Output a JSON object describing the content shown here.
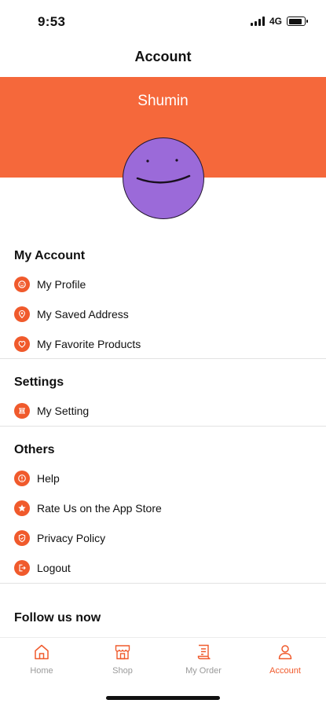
{
  "status": {
    "time": "9:53",
    "network": "4G",
    "battery_level": 0.85,
    "signal_icon": "signal-icon",
    "battery_icon": "battery-icon"
  },
  "header": {
    "title": "Account"
  },
  "profile": {
    "name": "Shumin",
    "banner_color": "#f5683b",
    "avatar_color": "#9b6ad9"
  },
  "accent_color": "#f05a2c",
  "sections": {
    "my_account": {
      "title": "My Account",
      "items": [
        {
          "label": "My Profile",
          "icon": "profile-icon"
        },
        {
          "label": "My Saved Address",
          "icon": "location-pin-icon"
        },
        {
          "label": "My Favorite Products",
          "icon": "heart-icon"
        }
      ]
    },
    "settings": {
      "title": "Settings",
      "items": [
        {
          "label": "My Setting",
          "icon": "settings-icon"
        }
      ]
    },
    "others": {
      "title": "Others",
      "items": [
        {
          "label": "Help",
          "icon": "help-icon"
        },
        {
          "label": "Rate Us on the App Store",
          "icon": "star-icon"
        },
        {
          "label": "Privacy Policy",
          "icon": "shield-icon"
        },
        {
          "label": "Logout",
          "icon": "logout-icon"
        }
      ]
    },
    "follow": {
      "title": "Follow us now"
    }
  },
  "tabs": [
    {
      "label": "Home",
      "icon": "home-icon",
      "active": false
    },
    {
      "label": "Shop",
      "icon": "shop-icon",
      "active": false
    },
    {
      "label": "My Order",
      "icon": "order-icon",
      "active": false
    },
    {
      "label": "Account",
      "icon": "account-icon",
      "active": true
    }
  ]
}
